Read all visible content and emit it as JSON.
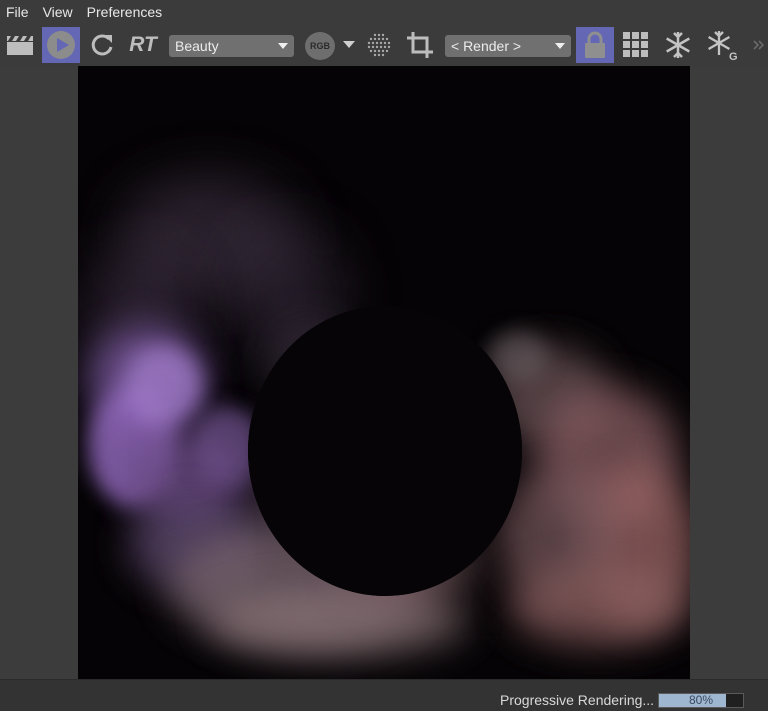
{
  "menu": {
    "items": [
      "File",
      "View",
      "Preferences"
    ]
  },
  "toolbar": {
    "rt_label": "RT",
    "pass_dropdown": {
      "value": "Beauty"
    },
    "channel_button": {
      "label": "RGB"
    },
    "camera_dropdown": {
      "value": "< Render >"
    },
    "icons": [
      "clapperboard-icon",
      "play-icon",
      "refresh-icon",
      "rt-icon",
      "rgb-channel-icon",
      "dots-grid-icon",
      "crop-icon",
      "lock-icon",
      "grid-icon",
      "snowflake-icon",
      "snowflake-g-icon",
      "overflow-chevron-icon"
    ],
    "active_color": "#6467b4"
  },
  "render_view": {
    "description_colors": {
      "smoke_purple": "#9a70c4",
      "smoke_pink": "#c8868a",
      "background": "#050305"
    }
  },
  "status": {
    "text": "Progressive Rendering...",
    "progress_percent": 80,
    "progress_label": "80%"
  }
}
